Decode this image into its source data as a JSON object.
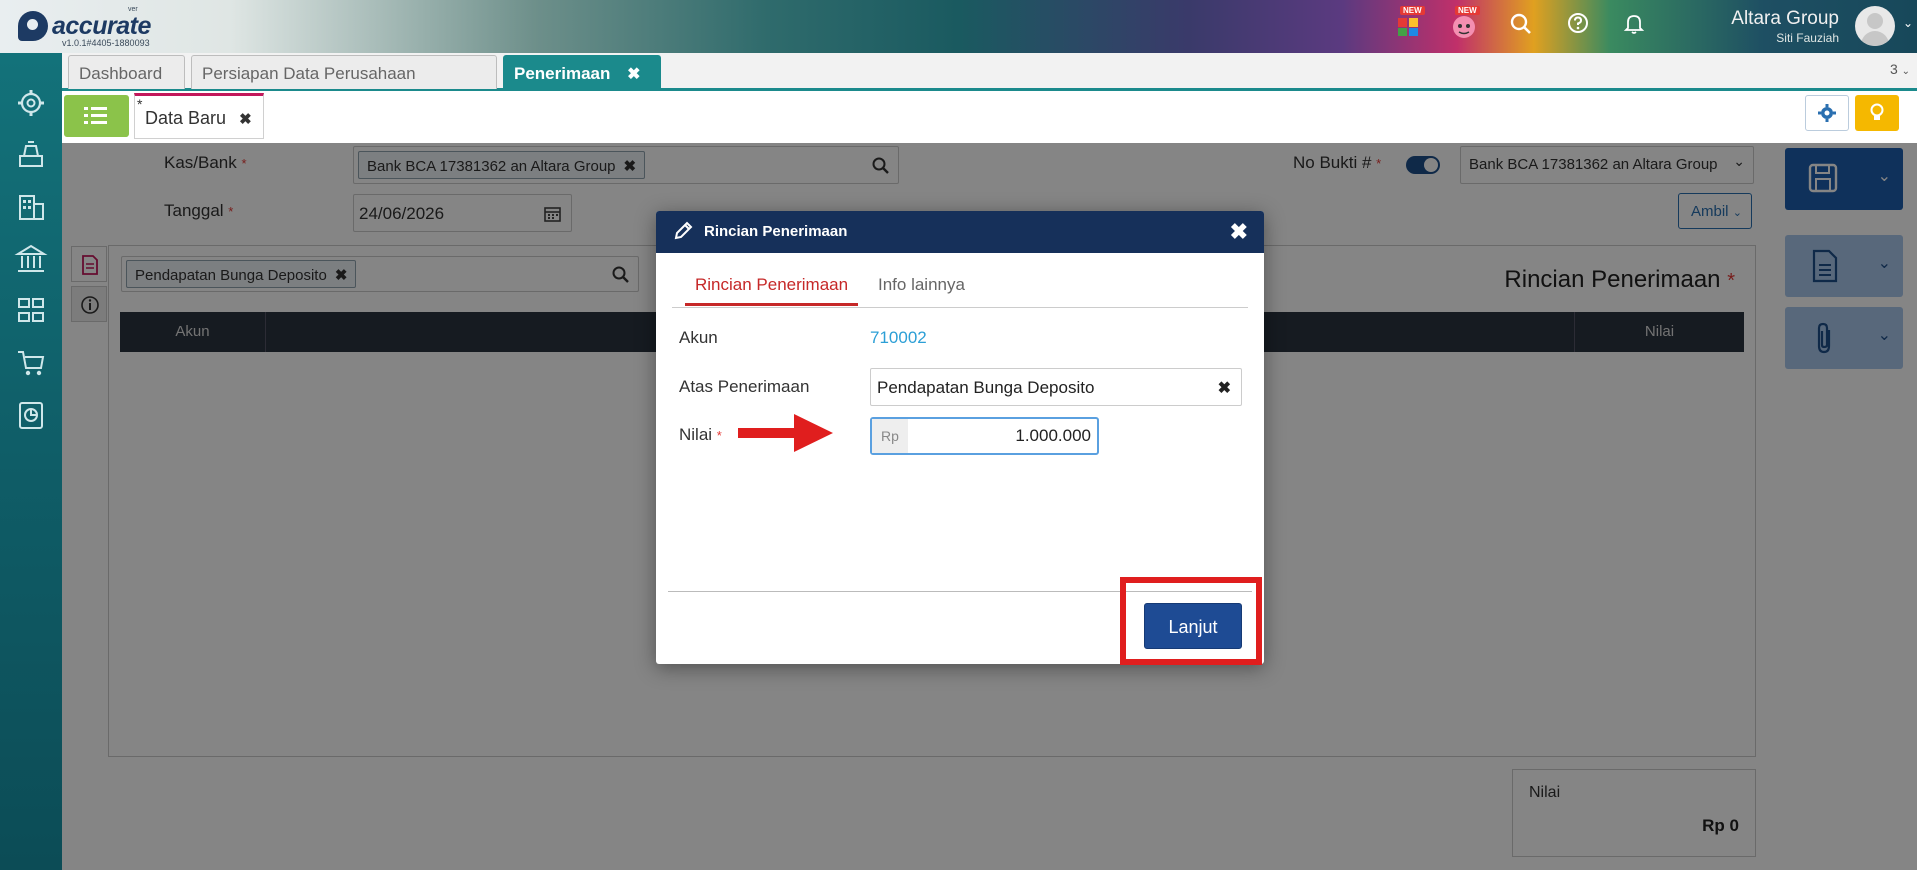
{
  "app": {
    "logo_text": "accurate",
    "logo_sup": "ver",
    "version": "v1.0.1#4405-1880093",
    "new_badge": "NEW",
    "company": "Altara Group",
    "user": "Siti Fauziah"
  },
  "tabs": [
    {
      "label": "Dashboard"
    },
    {
      "label": "Persiapan Data Perusahaan"
    },
    {
      "label": "Penerimaan",
      "close": "✖"
    }
  ],
  "tab_count": "3",
  "subtab": {
    "marker": "*",
    "label": "Data Baru",
    "close": "✖"
  },
  "form": {
    "kasbank_label": "Kas/Bank",
    "kasbank_value": "Bank BCA 17381362 an Altara Group",
    "tanggal_label": "Tanggal",
    "tanggal_value": "24/06/2026",
    "nobukti_label": "No Bukti #",
    "nobukti_value": "Bank BCA 17381362 an Altara Group",
    "ambil_label": "Ambil",
    "required_mark": "*",
    "chip_close": "✖"
  },
  "detail": {
    "search_chip": "Pendapatan Bunga Deposito",
    "title": "Rincian Penerimaan",
    "columns": [
      "Akun",
      "Nilai"
    ],
    "total_label": "Nilai",
    "total_value": "Rp 0"
  },
  "modal": {
    "title": "Rincian Penerimaan",
    "close": "✖",
    "tabs": [
      "Rincian Penerimaan",
      "Info lainnya"
    ],
    "akun_label": "Akun",
    "akun_value": "710002",
    "atas_label": "Atas Penerimaan",
    "atas_value": "Pendapatan Bunga Deposito",
    "atas_clear": "✖",
    "nilai_label": "Nilai",
    "nilai_currency": "Rp",
    "nilai_value": "1.000.000",
    "submit_label": "Lanjut"
  },
  "colors": {
    "header_navy": "#16305a",
    "accent_teal": "#1b8a8c",
    "tab_active_red": "#c62828",
    "button_blue": "#1e4b94",
    "annotation_red": "#e01e1e",
    "link_blue": "#2c9fd6"
  }
}
